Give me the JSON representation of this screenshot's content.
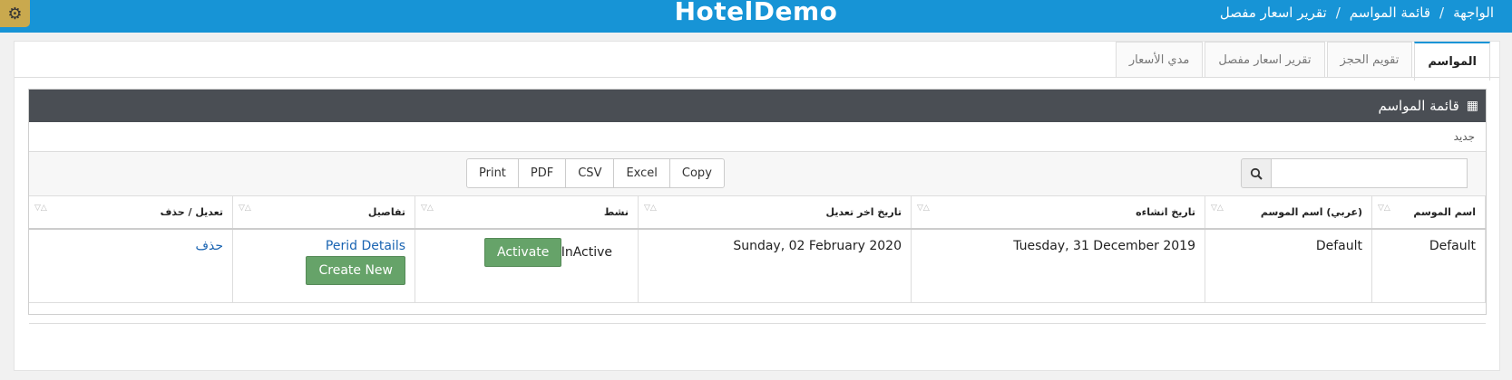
{
  "topbar": {
    "brand": "HotelDemo",
    "breadcrumb": [
      "الواجهة",
      "قائمة المواسم",
      "تقرير اسعار مفصل"
    ],
    "separator": "/"
  },
  "tabs": [
    "المواسم",
    "تقويم الحجز",
    "تقرير اسعار مفصل",
    "مدي الأسعار"
  ],
  "box": {
    "title": "قائمة المواسم",
    "new_label": "جديد"
  },
  "toolbar": {
    "buttons": [
      "Print",
      "PDF",
      "CSV",
      "Excel",
      "Copy"
    ],
    "search_value": ""
  },
  "table": {
    "headers": [
      "اسم الموسم",
      "(عربي) اسم الموسم",
      "تاريخ انشاءه",
      "تاريخ اخر تعديل",
      "نشط",
      "تفاصيل",
      "تعديل / حذف"
    ],
    "rows": [
      {
        "name": "Default",
        "name_ar": "Default",
        "created": "Tuesday, 31 December 2019",
        "modified": "Sunday, 02 February 2020",
        "status": "InActive",
        "activate_label": "Activate",
        "details_link": "Perid Details",
        "create_label": "Create New",
        "delete_label": "حذف"
      }
    ]
  },
  "colors": {
    "topbar": "#1794d6",
    "box_header": "#4a4e54",
    "green_button": "#66a369",
    "gear": "#c9a94e"
  },
  "icons": [
    "gear-icon",
    "grid-icon",
    "search-icon",
    "sort-icon"
  ]
}
